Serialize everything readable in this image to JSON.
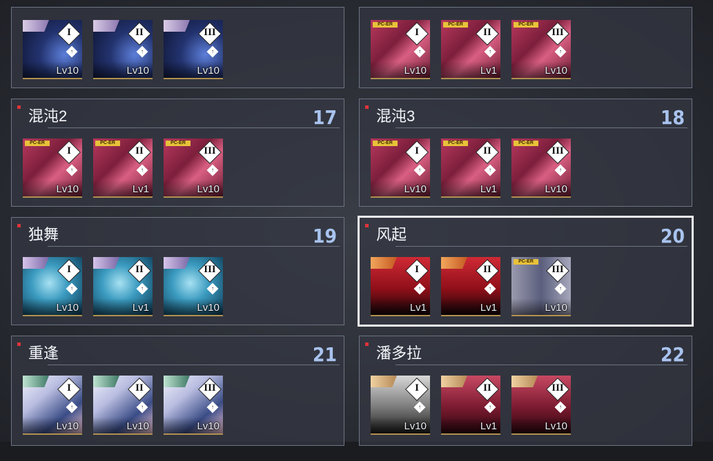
{
  "panels": [
    {
      "key": "p1",
      "title": "",
      "number": "",
      "cards": [
        {
          "tier": "I",
          "lv": "Lv10"
        },
        {
          "tier": "II",
          "lv": "Lv10"
        },
        {
          "tier": "III",
          "lv": "Lv10"
        }
      ]
    },
    {
      "key": "p2",
      "title": "",
      "number": "",
      "cards": [
        {
          "tier": "I",
          "lv": "Lv10",
          "tag": "PC-ER"
        },
        {
          "tier": "II",
          "lv": "Lv1",
          "tag": "PC-ER"
        },
        {
          "tier": "III",
          "lv": "Lv10",
          "tag": "PC-ER"
        }
      ]
    },
    {
      "key": "p17",
      "title": "混沌2",
      "number": "17",
      "cards": [
        {
          "tier": "I",
          "lv": "Lv10",
          "tag": "PC-ER"
        },
        {
          "tier": "II",
          "lv": "Lv1",
          "tag": "PC-ER"
        },
        {
          "tier": "III",
          "lv": "Lv10",
          "tag": "PC-ER"
        }
      ]
    },
    {
      "key": "p18",
      "title": "混沌3",
      "number": "18",
      "cards": [
        {
          "tier": "I",
          "lv": "Lv10",
          "tag": "PC-ER"
        },
        {
          "tier": "II",
          "lv": "Lv1",
          "tag": "PC-ER"
        },
        {
          "tier": "III",
          "lv": "Lv10",
          "tag": "PC-ER"
        }
      ]
    },
    {
      "key": "p19",
      "title": "独舞",
      "number": "19",
      "cards": [
        {
          "tier": "I",
          "lv": "Lv10"
        },
        {
          "tier": "II",
          "lv": "Lv1"
        },
        {
          "tier": "III",
          "lv": "Lv10"
        }
      ]
    },
    {
      "key": "p20",
      "title": "风起",
      "number": "20",
      "selected": true,
      "cards": [
        {
          "tier": "I",
          "lv": "Lv1"
        },
        {
          "tier": "II",
          "lv": "Lv1"
        },
        {
          "tier": "III",
          "lv": "Lv10",
          "tag": "PC-ER"
        }
      ]
    },
    {
      "key": "p21",
      "title": "重逢",
      "number": "21",
      "cards": [
        {
          "tier": "I",
          "lv": "Lv10"
        },
        {
          "tier": "II",
          "lv": "Lv10"
        },
        {
          "tier": "III",
          "lv": "Lv10"
        }
      ]
    },
    {
      "key": "p22",
      "title": "潘多拉",
      "number": "22",
      "cards": [
        {
          "tier": "I",
          "lv": "Lv10"
        },
        {
          "tier": "II",
          "lv": "Lv1"
        },
        {
          "tier": "III",
          "lv": "Lv10"
        }
      ]
    }
  ],
  "icons": {
    "tier": "roman-diamond-icon",
    "lock": "lock-diamond-icon"
  },
  "colors": {
    "accent_number": "#a9c3ee",
    "red_marker": "#e0333a",
    "panel_border": "#6d7483",
    "selected_border": "#f2f3f5"
  }
}
